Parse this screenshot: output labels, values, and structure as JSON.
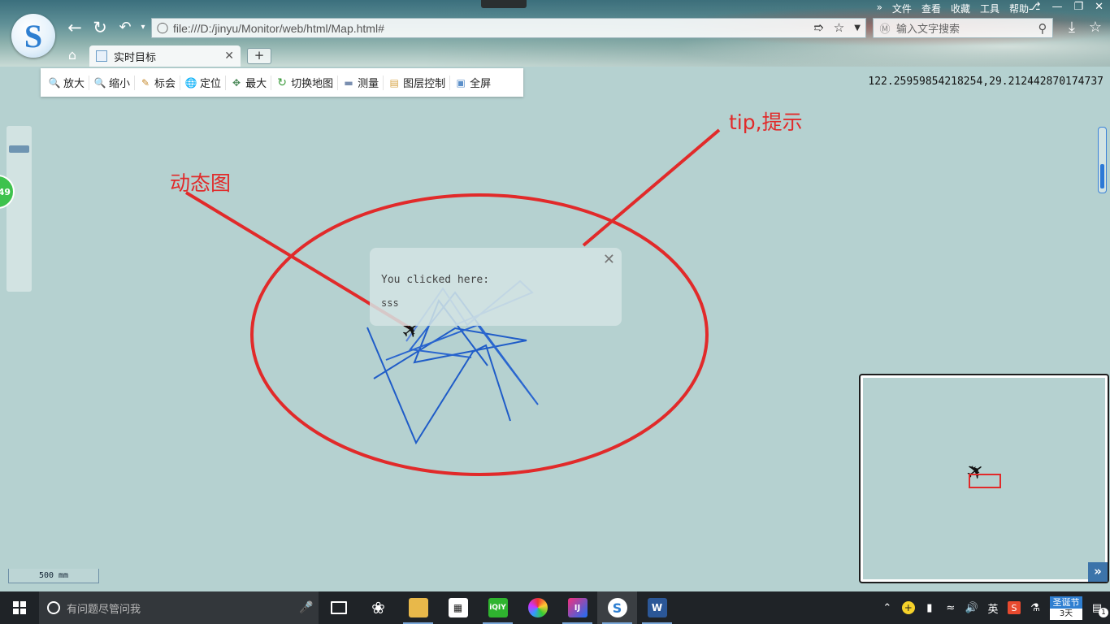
{
  "browser": {
    "address_url": "file:///D:/jinyu/Monitor/web/html/Map.html#",
    "search_placeholder": "输入文字搜索",
    "menu": [
      "文件",
      "查看",
      "收藏",
      "工具",
      "帮助"
    ],
    "menu_more": "»",
    "tab_title": "实时目标",
    "logo_letter": "S",
    "new_tab": "+"
  },
  "map": {
    "toolbar": [
      {
        "label": "放大",
        "icon": "zoom-in-icon"
      },
      {
        "label": "缩小",
        "icon": "zoom-out-icon"
      },
      {
        "label": "标会",
        "icon": "pencil-icon"
      },
      {
        "label": "定位",
        "icon": "globe-icon"
      },
      {
        "label": "最大",
        "icon": "full-extent-icon"
      },
      {
        "label": "切换地图",
        "icon": "refresh-icon"
      },
      {
        "label": "测量",
        "icon": "ruler-icon"
      },
      {
        "label": "图层控制",
        "icon": "layers-icon"
      },
      {
        "label": "全屏",
        "icon": "fullscreen-icon"
      }
    ],
    "coordinates": "122.25959854218254,29.212442870174737",
    "popup_message": "You clicked here:",
    "popup_value": "sss",
    "scale_label": "500 mm",
    "badge_count": "49",
    "minimap_toggle": "»"
  },
  "annotations": {
    "dynamic": "动态图",
    "tip": "tip,提示",
    "color": "#e12a2a"
  },
  "taskbar": {
    "search_placeholder": "有问题尽管问我",
    "ime": "英",
    "festival": "圣诞节",
    "days": "3天",
    "notifications": "1"
  }
}
